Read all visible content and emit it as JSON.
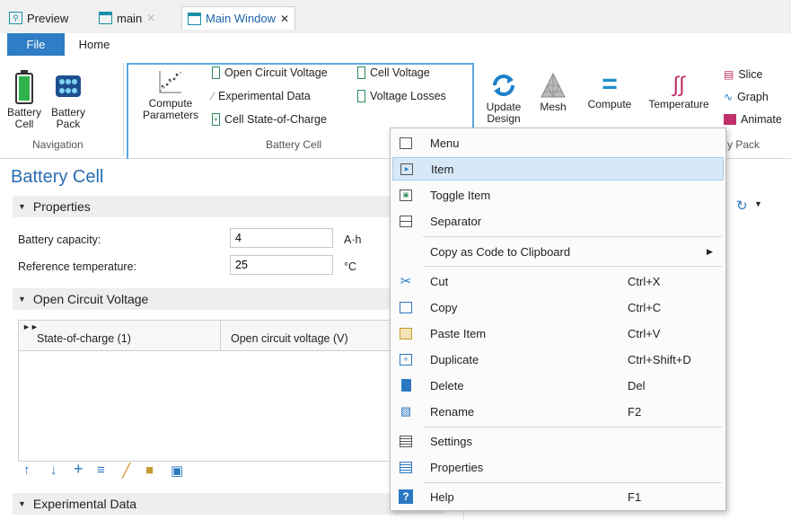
{
  "tabs": [
    {
      "label": "Preview",
      "icon": "preview-icon"
    },
    {
      "label": "main",
      "icon": "window-icon"
    },
    {
      "label": "Main Window",
      "icon": "window-icon"
    }
  ],
  "ribbon": {
    "file_label": "File",
    "home_label": "Home",
    "navigation": {
      "battery_cell_l1": "Battery",
      "battery_cell_l2": "Cell",
      "battery_pack_l1": "Battery",
      "battery_pack_l2": "Pack",
      "group_label": "Navigation"
    },
    "battery_cell": {
      "compute_l1": "Compute",
      "compute_l2": "Parameters",
      "open_circuit_voltage": "Open Circuit Voltage",
      "experimental_data": "Experimental Data",
      "cell_soc": "Cell State-of-Charge",
      "cell_voltage": "Cell Voltage",
      "voltage_losses": "Voltage Losses",
      "group_label": "Battery Cell"
    },
    "pack": {
      "update_l1": "Update",
      "update_l2": "Design",
      "mesh": "Mesh",
      "compute": "Compute",
      "temperature": "Temperature",
      "slice": "Slice",
      "graph": "Graph",
      "animate": "Animate",
      "group_label": "y Pack"
    }
  },
  "pane": {
    "title": "Battery Cell",
    "properties_header": "Properties",
    "battery_capacity_label": "Battery capacity:",
    "battery_capacity_value": "4",
    "battery_capacity_unit": "A·h",
    "ref_temp_label": "Reference temperature:",
    "ref_temp_value": "25",
    "ref_temp_unit": "°C",
    "ocv_header": "Open Circuit Voltage",
    "table_col1": "State-of-charge (1)",
    "table_col2": "Open circuit voltage (V)",
    "experimental_header": "Experimental Data"
  },
  "context_menu": {
    "items": [
      {
        "label": "Menu",
        "shortcut": "",
        "icon": "menu-icon"
      },
      {
        "label": "Item",
        "shortcut": "",
        "icon": "item-icon"
      },
      {
        "label": "Toggle Item",
        "shortcut": "",
        "icon": "toggle-item-icon"
      },
      {
        "label": "Separator",
        "shortcut": "",
        "icon": "separator-icon"
      },
      {
        "label": "Copy as Code to Clipboard",
        "shortcut": "",
        "icon": ""
      },
      {
        "label": "Cut",
        "shortcut": "Ctrl+X",
        "icon": "scissors-icon"
      },
      {
        "label": "Copy",
        "shortcut": "Ctrl+C",
        "icon": "copy-icon"
      },
      {
        "label": "Paste Item",
        "shortcut": "Ctrl+V",
        "icon": "paste-icon"
      },
      {
        "label": "Duplicate",
        "shortcut": "Ctrl+Shift+D",
        "icon": "duplicate-icon"
      },
      {
        "label": "Delete",
        "shortcut": "Del",
        "icon": "trash-icon"
      },
      {
        "label": "Rename",
        "shortcut": "F2",
        "icon": "rename-icon"
      },
      {
        "label": "Settings",
        "shortcut": "",
        "icon": "settings-icon"
      },
      {
        "label": "Properties",
        "shortcut": "",
        "icon": "properties-icon"
      },
      {
        "label": "Help",
        "shortcut": "F1",
        "icon": "help-icon"
      }
    ]
  },
  "colors": {
    "accent": "#2f7dc4",
    "highlight": "#d7e8f7",
    "group_border": "#5aa8df"
  }
}
